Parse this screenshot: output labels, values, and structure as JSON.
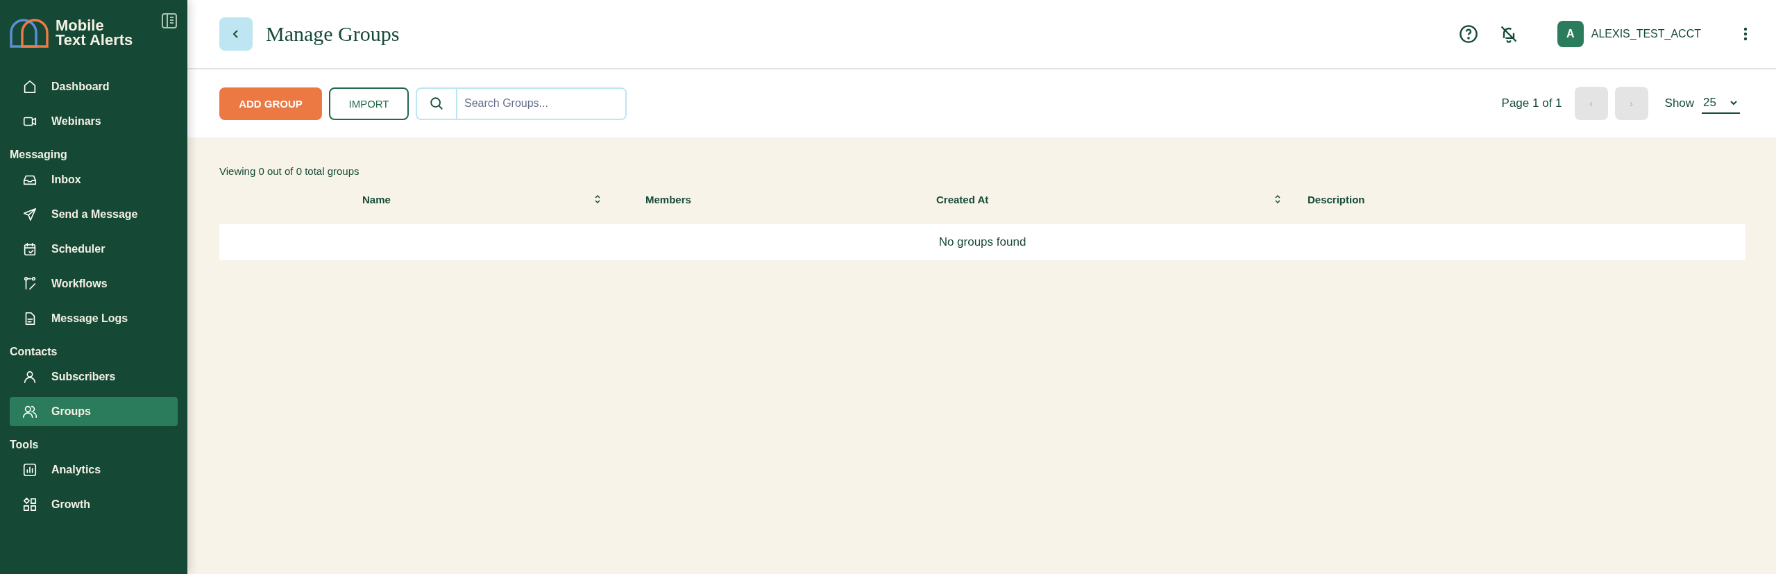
{
  "brand": {
    "line1": "Mobile",
    "line2": "Text Alerts"
  },
  "sidebar": {
    "sections": [
      {
        "items": [
          {
            "label": "Dashboard",
            "selected": false
          },
          {
            "label": "Webinars",
            "selected": false
          }
        ]
      },
      {
        "heading": "Messaging",
        "items": [
          {
            "label": "Inbox",
            "selected": false
          },
          {
            "label": "Send a Message",
            "selected": false
          },
          {
            "label": "Scheduler",
            "selected": false
          },
          {
            "label": "Workflows",
            "selected": false
          },
          {
            "label": "Message Logs",
            "selected": false
          }
        ]
      },
      {
        "heading": "Contacts",
        "items": [
          {
            "label": "Subscribers",
            "selected": false
          },
          {
            "label": "Groups",
            "selected": true
          }
        ]
      },
      {
        "heading": "Tools",
        "items": [
          {
            "label": "Analytics",
            "selected": false
          },
          {
            "label": "Growth",
            "selected": false
          }
        ]
      }
    ]
  },
  "header": {
    "title": "Manage Groups",
    "account": {
      "initial": "A",
      "name": "ALEXIS_TEST_ACCT"
    }
  },
  "toolbar": {
    "add_button": "ADD GROUP",
    "import_button": "IMPORT",
    "search": {
      "placeholder": "Search Groups..."
    },
    "page_label": "Page 1 of 1",
    "prev": {
      "label": "‹",
      "disabled": true
    },
    "next": {
      "label": "›",
      "disabled": true
    },
    "show_label": "Show",
    "page_size": "25"
  },
  "table": {
    "summary": "Viewing 0 out of 0 total groups",
    "columns": [
      {
        "label": "Name",
        "sortable": true
      },
      {
        "label": "Members",
        "sortable": false
      },
      {
        "label": "Created At",
        "sortable": true
      },
      {
        "label": "Description",
        "sortable": false
      }
    ],
    "empty_message": "No groups found"
  }
}
